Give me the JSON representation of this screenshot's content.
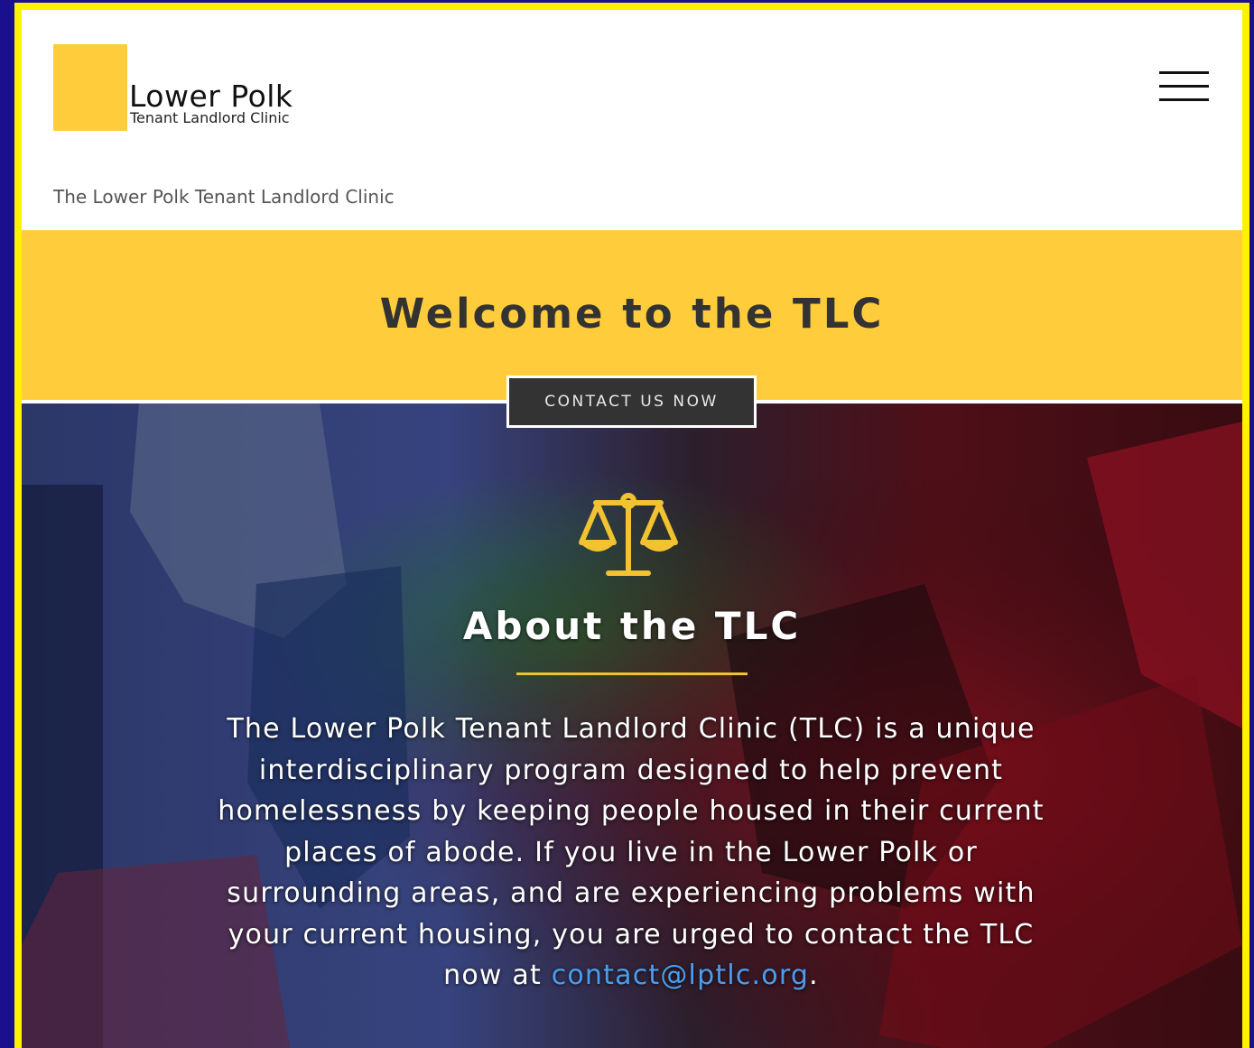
{
  "header": {
    "logo_title": "Lower Polk",
    "logo_subtitle": "Tenant Landlord Clinic",
    "tagline": "The Lower Polk Tenant Landlord Clinic"
  },
  "hero": {
    "title": "Welcome to the TLC",
    "cta_label": "CONTACT US NOW"
  },
  "about": {
    "icon": "scales-of-justice-icon",
    "title": "About the TLC",
    "body": "The Lower Polk Tenant Landlord Clinic (TLC) is a unique interdisciplinary program designed to help prevent homelessness by keeping people housed in their current places of abode. If you live in the Lower Polk or surrounding areas, and are experiencing problems with your current housing, you are urged to contact the TLC now at ",
    "email": "contact@lptlc.org",
    "trailing": "."
  },
  "colors": {
    "brand_yellow": "#ffcd3c",
    "frame_yellow": "#fff200",
    "outer_blue": "#1a0f8c",
    "button_dark": "#333333",
    "link_blue": "#4a9ef0"
  }
}
